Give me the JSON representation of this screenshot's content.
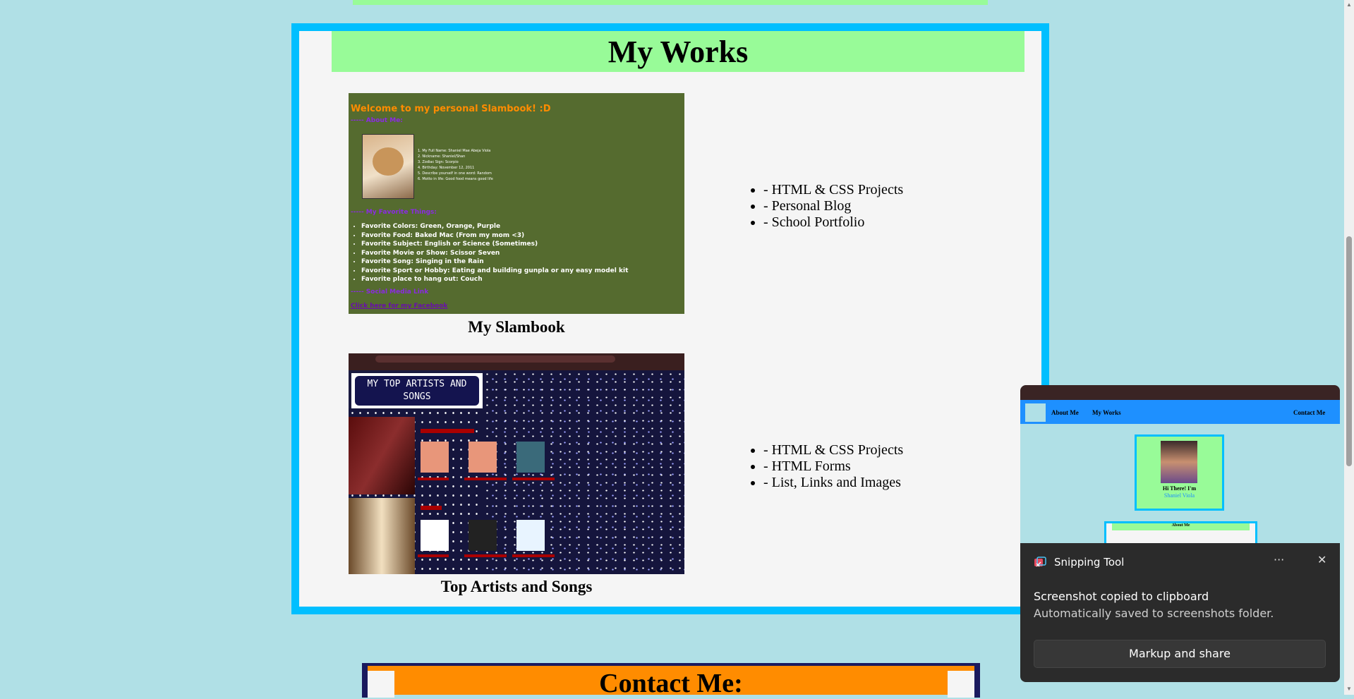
{
  "works": {
    "title": "My Works",
    "projects": [
      {
        "caption": "My Slambook",
        "features": [
          "- HTML & CSS Projects",
          "- Personal Blog",
          "- School Portfolio"
        ]
      },
      {
        "caption": "Top Artists and Songs",
        "features": [
          "- HTML & CSS Projects",
          "- HTML Forms",
          "- List, Links and Images"
        ]
      }
    ]
  },
  "slambook_thumb": {
    "title": "Welcome to my personal Slambook! :D",
    "about_heading": "----- About Me:",
    "facts": [
      "1. My Full Name: Shaniel Mae Abeja Viola",
      "2. Nickname: Shaniel/Shan",
      "3. Zodiac Sign: Scorpio",
      "4. Birthday: November 12, 2011",
      "5. Describe yourself in one word: Random",
      "6. Motto in life: Good food means good life"
    ],
    "favorites_heading": "----- My Favorite Things:",
    "favorites": [
      "Favorite Colors: Green, Orange, Purple",
      "Favorite Food: Baked Mac (From my mom <3)",
      "Favorite Subject: English or Science (Sometimes)",
      "Favorite Movie or Show: Scissor Seven",
      "Favorite Song: Singing in the Rain",
      "Favorite Sport or Hobby: Eating and building gunpla or any easy model kit",
      "Favorite place to hang out: Couch"
    ],
    "social_heading": "----- Social Media Link",
    "link": "Click here for my Facebook"
  },
  "artists_thumb": {
    "title": "MY TOP ARTISTS AND SONGS"
  },
  "notification": {
    "app": "Snipping Tool",
    "more_icon": "ellipsis-icon",
    "close_icon": "close-icon",
    "heading": "Screenshot copied to clipboard",
    "subtext": "Automatically saved to screenshots folder.",
    "button": "Markup and share",
    "preview": {
      "nav": [
        "About Me",
        "My Works",
        "Contact Me"
      ],
      "greeting": "Hi There! I'm",
      "name": "Shaniel Viola",
      "about_heading": "About Me"
    }
  },
  "contact": {
    "title": "Contact Me:"
  },
  "colors": {
    "page_bg": "#b0e0e6",
    "accent_green": "#98fb98",
    "border_blue": "#00bfff",
    "contact_orange": "#ff8c00"
  }
}
